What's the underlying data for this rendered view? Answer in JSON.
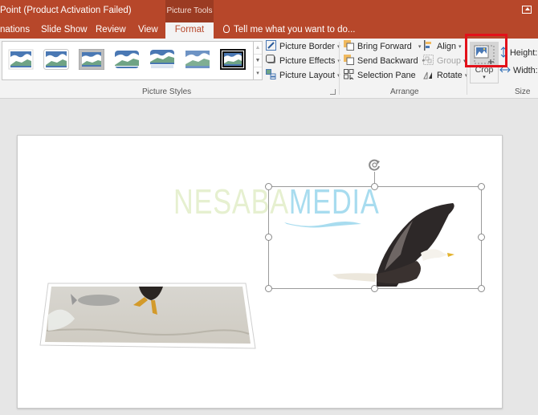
{
  "titlebar": {
    "title": "Point (Product Activation Failed)",
    "contextual_tab_group": "Picture Tools",
    "restore_icon": "ribbon-display-options-icon"
  },
  "tabs": [
    {
      "label": "nations",
      "active": false
    },
    {
      "label": "Slide Show",
      "active": false
    },
    {
      "label": "Review",
      "active": false
    },
    {
      "label": "View",
      "active": false
    },
    {
      "label": "Format",
      "active": true
    }
  ],
  "tell_me": {
    "icon": "lightbulb-icon",
    "placeholder": "Tell me what you want to do..."
  },
  "ribbon": {
    "picture_styles": {
      "group_label": "Picture Styles",
      "gallery_count": 7,
      "selected_index": 6,
      "scroll_up": "▲",
      "scroll_down": "▼",
      "more": "▾"
    },
    "picture_format": [
      {
        "label": "Picture Border",
        "icon": "pen-border-icon",
        "dropdown": "▾"
      },
      {
        "label": "Picture Effects",
        "icon": "effects-icon",
        "dropdown": "▾"
      },
      {
        "label": "Picture Layout",
        "icon": "layout-icon",
        "dropdown": "▾"
      }
    ],
    "arrange": {
      "group_label": "Arrange",
      "items": [
        {
          "label": "Bring Forward",
          "icon": "bring-forward-icon",
          "dropdown": "▾",
          "enabled": true
        },
        {
          "label": "Send Backward",
          "icon": "send-backward-icon",
          "dropdown": "▾",
          "enabled": true
        },
        {
          "label": "Selection Pane",
          "icon": "selection-pane-icon",
          "dropdown": "",
          "enabled": true
        },
        {
          "label": "Align",
          "icon": "align-icon",
          "dropdown": "▾",
          "enabled": true
        },
        {
          "label": "Group",
          "icon": "group-icon",
          "dropdown": "▾",
          "enabled": false
        },
        {
          "label": "Rotate",
          "icon": "rotate-icon",
          "dropdown": "▾",
          "enabled": true
        }
      ]
    },
    "size": {
      "group_label": "Size",
      "crop_label": "Crop",
      "crop_dropdown": "▾",
      "height_label": "Height:",
      "width_label": "Width:"
    }
  },
  "slide": {
    "watermark": {
      "part1": "NESABA",
      "part2": "MEDIA"
    },
    "images": [
      {
        "name": "eagle-catching-fish-photo",
        "style": "perspective tilted frame"
      },
      {
        "name": "flying-eagle-photo",
        "selected": true
      }
    ]
  },
  "colors": {
    "accent": "#b7472a",
    "highlight_box": "#e3111a"
  }
}
